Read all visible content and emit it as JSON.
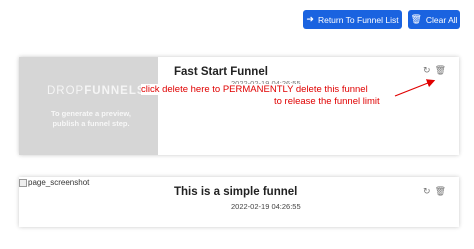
{
  "toolbar": {
    "return_label": "Return To Funnel List",
    "return_icon": "arrow-left-icon",
    "clear_label": "Clear All",
    "clear_icon": "trash-icon",
    "accent": "#1a63e0"
  },
  "cards": [
    {
      "title": "Fast Start Funnel",
      "date": "2022-02-19 04:26:55",
      "preview": {
        "logo_bold": "DROP",
        "logo_rest": "FUNNELS",
        "message": "To generate a preview, publish a funnel step."
      }
    },
    {
      "title": "This is a simple funnel",
      "date": "2022-02-19 04:26:55",
      "broken_image_alt": "page_screenshot"
    }
  ],
  "annotation": {
    "line1": "click delete here to PERMANENTLY delete this funnel",
    "line2": "to release the funnel limit",
    "color": "#e00000"
  }
}
